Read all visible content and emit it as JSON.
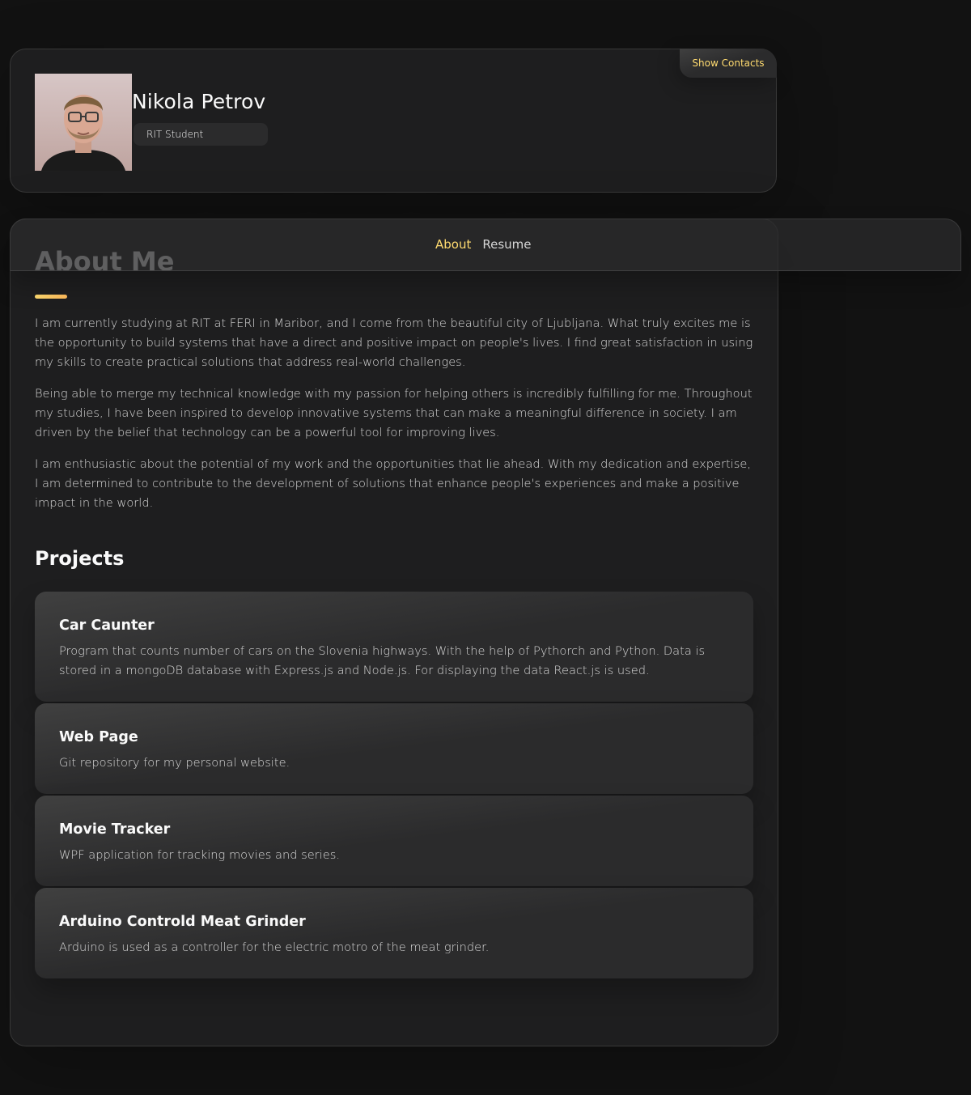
{
  "profile": {
    "name": "Nikola Petrov",
    "title": "RIT Student",
    "show_contacts_label": "Show Contacts"
  },
  "navbar": {
    "links": [
      {
        "label": "About",
        "active": true
      },
      {
        "label": "Resume",
        "active": false
      }
    ]
  },
  "about": {
    "heading": "About Me",
    "paragraphs": [
      "I am currently studying at RIT at FERI in Maribor, and I come from the beautiful city of Ljubljana. What truly excites me is the opportunity to build systems that have a direct and positive impact on people's lives. I find great satisfaction in using my skills to create practical solutions that address real-world challenges.",
      "Being able to merge my technical knowledge with my passion for helping others is incredibly fulfilling for me. Throughout my studies, I have been inspired to develop innovative systems that can make a meaningful difference in society. I am driven by the belief that technology can be a powerful tool for improving lives.",
      "I am enthusiastic about the potential of my work and the opportunities that lie ahead. With my dedication and expertise, I am determined to contribute to the development of solutions that enhance people's experiences and make a positive impact in the world."
    ]
  },
  "projects": {
    "heading": "Projects",
    "items": [
      {
        "name": "Car Caunter",
        "description": "Program that counts number of cars on the Slovenia highways. With the help of Pythorch and Python. Data is stored in a mongoDB database with Express.js and Node.js. For displaying the data React.js is used."
      },
      {
        "name": "Web Page",
        "description": "Git repository for my personal website."
      },
      {
        "name": "Movie Tracker",
        "description": "WPF application for tracking movies and series."
      },
      {
        "name": "Arduino Controld Meat Grinder",
        "description": "Arduino is used as a controller for the electric motro of the meat grinder."
      }
    ]
  },
  "colors": {
    "accent": "#ffdb70",
    "background": "#121212",
    "card": "#1e1e1f"
  }
}
